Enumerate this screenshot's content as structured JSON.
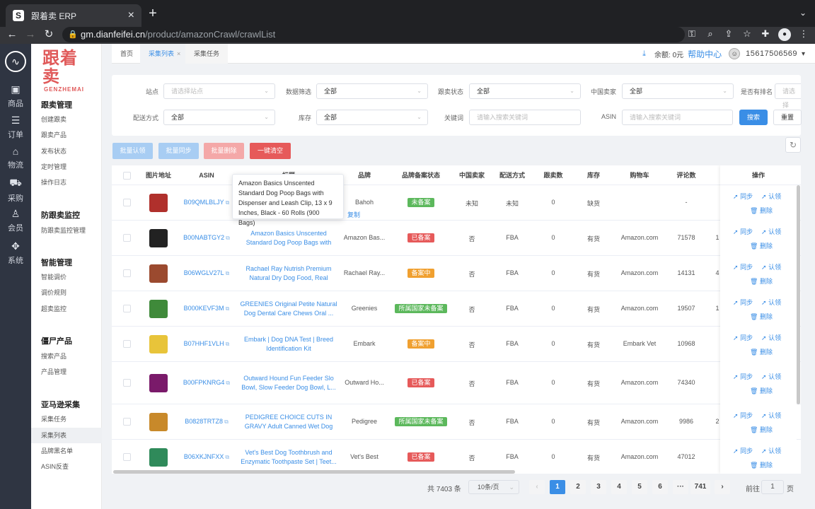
{
  "browser": {
    "tab_title": "跟着卖 ERP",
    "favicon": "S",
    "url_host": "gm.dianfeifei.cn",
    "url_path": "/product/amazonCrawl/crawlList"
  },
  "rail": {
    "items": [
      "商品",
      "订单",
      "物流",
      "采购",
      "会员",
      "系统"
    ]
  },
  "brand": {
    "cn": "跟着卖",
    "en": "GENZHEMAI"
  },
  "sidebar": {
    "groups": [
      {
        "title": "跟卖管理",
        "items": [
          "创建跟卖",
          "跟卖产品",
          "发布状态",
          "定时管理",
          "操作日志"
        ]
      },
      {
        "title": "防跟卖监控",
        "items": [
          "防跟卖监控管理"
        ]
      },
      {
        "title": "智能管理",
        "items": [
          "智能调价",
          "调价规则",
          "超卖监控"
        ]
      },
      {
        "title": "僵尸产品",
        "items": [
          "搜索产品",
          "产品管理"
        ]
      },
      {
        "title": "亚马逊采集",
        "items": [
          "采集任务",
          "采集列表",
          "品牌黑名单",
          "ASIN反查"
        ]
      }
    ]
  },
  "page_tabs": [
    "首页",
    "采集列表",
    "采集任务"
  ],
  "topbar": {
    "balance": "余额: 0元",
    "help": "帮助中心",
    "phone": "15617506569"
  },
  "filters": {
    "site_label": "站点",
    "site_placeholder": "请选择站点",
    "screen_label": "数据筛选",
    "screen_value": "全部",
    "follow_status_label": "跟卖状态",
    "follow_status_value": "全部",
    "cn_seller_label": "中国卖家",
    "cn_seller_value": "全部",
    "rank_label": "是否有排名",
    "rank_placeholder": "请选择",
    "ship_label": "配送方式",
    "ship_value": "全部",
    "stock_label": "库存",
    "stock_value": "全部",
    "keyword_label": "关键词",
    "keyword_placeholder": "请输入搜索关键词",
    "asin_label": "ASIN",
    "asin_placeholder": "请输入搜索关键词",
    "search": "搜索",
    "reset": "重置"
  },
  "actions": {
    "batch_claim": "批量认领",
    "batch_sync": "批量同步",
    "batch_delete": "批量删除",
    "clear_all": "一键清空"
  },
  "table": {
    "headers": [
      "图片地址",
      "ASIN",
      "标题",
      "品牌",
      "品牌备案状态",
      "中国卖家",
      "配送方式",
      "跟卖数",
      "库存",
      "购物车",
      "评论数",
      "",
      "操作"
    ],
    "op_sync": "同步",
    "op_claim": "认领",
    "op_delete": "删除",
    "rows": [
      {
        "asin": "B09QMLBLJY",
        "title": "",
        "brand": "Bahoh",
        "status": "未备案",
        "cn": "未知",
        "ship": "未知",
        "follow": "0",
        "stock": "缺货",
        "cart": "",
        "reviews": "-",
        "extra": "",
        "thumb": "#b0302c"
      },
      {
        "asin": "B00NABTGY2",
        "title": "Amazon Basics Unscented Standard Dog Poop Bags with Disp...",
        "brand": "Amazon Bas...",
        "status": "已备案",
        "cn": "否",
        "ship": "FBA",
        "follow": "0",
        "stock": "有货",
        "cart": "Amazon.com",
        "reviews": "71578",
        "extra": "1",
        "thumb": "#222222"
      },
      {
        "asin": "B06WGLV27L",
        "title": "Rachael Ray Nutrish Premium Natural Dry Dog Food, Real Beef,...",
        "brand": "Rachael Ray...",
        "status": "备案中",
        "cn": "否",
        "ship": "FBA",
        "follow": "0",
        "stock": "有货",
        "cart": "Amazon.com",
        "reviews": "14131",
        "extra": "4",
        "thumb": "#9b4a2f"
      },
      {
        "asin": "B000KEVF3M",
        "title": "GREENIES Original Petite Natural Dog Dental Care Chews Oral ...",
        "brand": "Greenies",
        "status": "所属国家未备案",
        "cn": "否",
        "ship": "FBA",
        "follow": "0",
        "stock": "有货",
        "cart": "Amazon.com",
        "reviews": "19507",
        "extra": "1",
        "thumb": "#3f8a3a"
      },
      {
        "asin": "B07HHF1VLH",
        "title": "Embark | Dog DNA Test | Breed Identification Kit",
        "brand": "Embark",
        "status": "备案中",
        "cn": "否",
        "ship": "FBA",
        "follow": "0",
        "stock": "有货",
        "cart": "Embark Vet",
        "reviews": "10968",
        "extra": "",
        "thumb": "#e8c43a"
      },
      {
        "asin": "B00FPKNRG4",
        "title": "Outward Hound Fun Feeder Slo Bowl, Slow Feeder Dog Bowl, L...",
        "brand": "Outward Ho...",
        "status": "已备案",
        "cn": "否",
        "ship": "FBA",
        "follow": "0",
        "stock": "有货",
        "cart": "Amazon.com",
        "reviews": "74340",
        "extra": "",
        "thumb": "#7a1a6a"
      },
      {
        "asin": "B0828TRTZ8",
        "title": "PEDIGREE CHOICE CUTS IN GRAVY Adult Canned Wet Dog Fo...",
        "brand": "Pedigree",
        "status": "所属国家未备案",
        "cn": "否",
        "ship": "FBA",
        "follow": "0",
        "stock": "有货",
        "cart": "Amazon.com",
        "reviews": "9986",
        "extra": "2",
        "thumb": "#c8892a"
      },
      {
        "asin": "B06XKJNFXX",
        "title": "Vet's Best Dog Toothbrush and Enzymatic Toothpaste Set | Teet...",
        "brand": "Vet's Best",
        "status": "已备案",
        "cn": "否",
        "ship": "FBA",
        "follow": "0",
        "stock": "有货",
        "cart": "Amazon.com",
        "reviews": "47012",
        "extra": "",
        "thumb": "#2f8a5a"
      }
    ]
  },
  "status_colors": {
    "未备案": "#5cb85c",
    "已备案": "#e65a5a",
    "备案中": "#f0a030",
    "所属国家未备案": "#5cb85c"
  },
  "tooltip": {
    "text": "Amazon Basics Unscented Standard Dog Poop Bags with Dispenser and Leash Clip, 13 x 9 Inches, Black - 60 Rolls (900 Bags)",
    "copy": "复制"
  },
  "pager": {
    "total": "共 7403 条",
    "page_size": "10条/页",
    "pages": [
      "1",
      "2",
      "3",
      "4",
      "5",
      "6",
      "···",
      "741"
    ],
    "goto_label": "前往",
    "goto_value": "1",
    "goto_suffix": "页"
  }
}
